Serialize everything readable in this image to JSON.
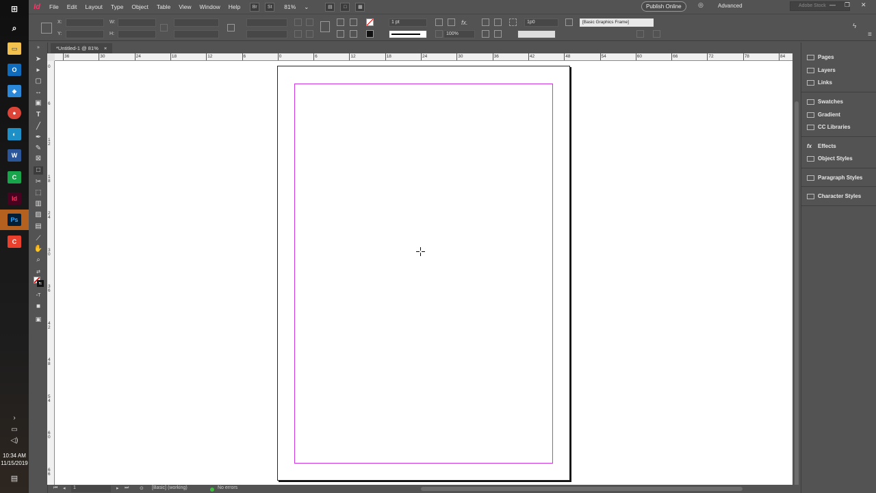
{
  "taskbar": {
    "apps": [
      {
        "name": "file-explorer",
        "glyph": "▭"
      },
      {
        "name": "outlook",
        "glyph": "O"
      },
      {
        "name": "app-blue",
        "glyph": "◆"
      },
      {
        "name": "chrome",
        "glyph": "●"
      },
      {
        "name": "app-cyan",
        "glyph": "◐"
      },
      {
        "name": "word",
        "glyph": "W"
      },
      {
        "name": "camtasia",
        "glyph": "C"
      },
      {
        "name": "indesign",
        "glyph": "Id"
      },
      {
        "name": "photoshop",
        "glyph": "Ps"
      },
      {
        "name": "app-red",
        "glyph": "C"
      }
    ],
    "time": "10:34 AM",
    "date": "11/15/2019"
  },
  "menubar": {
    "app_logo": "Id",
    "items": [
      "File",
      "Edit",
      "Layout",
      "Type",
      "Object",
      "Table",
      "View",
      "Window",
      "Help"
    ],
    "bridge": "Br",
    "stock": "St",
    "zoom": "81%",
    "publish": "Publish Online",
    "workspace": "Advanced",
    "search_placeholder": "Adobe Stock"
  },
  "control": {
    "x_label": "X:",
    "y_label": "Y:",
    "w_label": "W:",
    "h_label": "H:",
    "stroke_weight": "1 pt",
    "opacity": "100%",
    "offset": "1p0",
    "object_style": "[Basic Graphics Frame]"
  },
  "document": {
    "tab_title": "*Untitled-1 @ 81%",
    "close": "×"
  },
  "rulers": {
    "h_labels": [
      "36",
      "30",
      "24",
      "18",
      "12",
      "6",
      "0",
      "6",
      "12",
      "18",
      "24",
      "30",
      "36",
      "42",
      "48",
      "54",
      "60",
      "66",
      "72",
      "78",
      "84"
    ],
    "v_labels": [
      "0",
      "6",
      "1 2",
      "1 8",
      "2 4",
      "3 0",
      "3 6",
      "4 2",
      "4 8",
      "5 4",
      "6 0",
      "6 6"
    ]
  },
  "status": {
    "page": "1",
    "preflight_profile": "[Basic] (working)",
    "errors": "No errors"
  },
  "panels": [
    {
      "label": "Pages",
      "icon": "pages-icon"
    },
    {
      "label": "Layers",
      "icon": "layers-icon"
    },
    {
      "label": "Links",
      "icon": "links-icon"
    },
    {
      "label": "Swatches",
      "icon": "swatches-icon"
    },
    {
      "label": "Gradient",
      "icon": "gradient-icon"
    },
    {
      "label": "CC Libraries",
      "icon": "cc-libraries-icon"
    },
    {
      "label": "Effects",
      "icon": "effects-icon"
    },
    {
      "label": "Object Styles",
      "icon": "object-styles-icon"
    },
    {
      "label": "Paragraph Styles",
      "icon": "paragraph-styles-icon"
    },
    {
      "label": "Character Styles",
      "icon": "character-styles-icon"
    }
  ],
  "colors": {
    "margin_guide": "#d033e0",
    "ui_bg": "#535353",
    "indesign_brand": "#ff3366"
  }
}
